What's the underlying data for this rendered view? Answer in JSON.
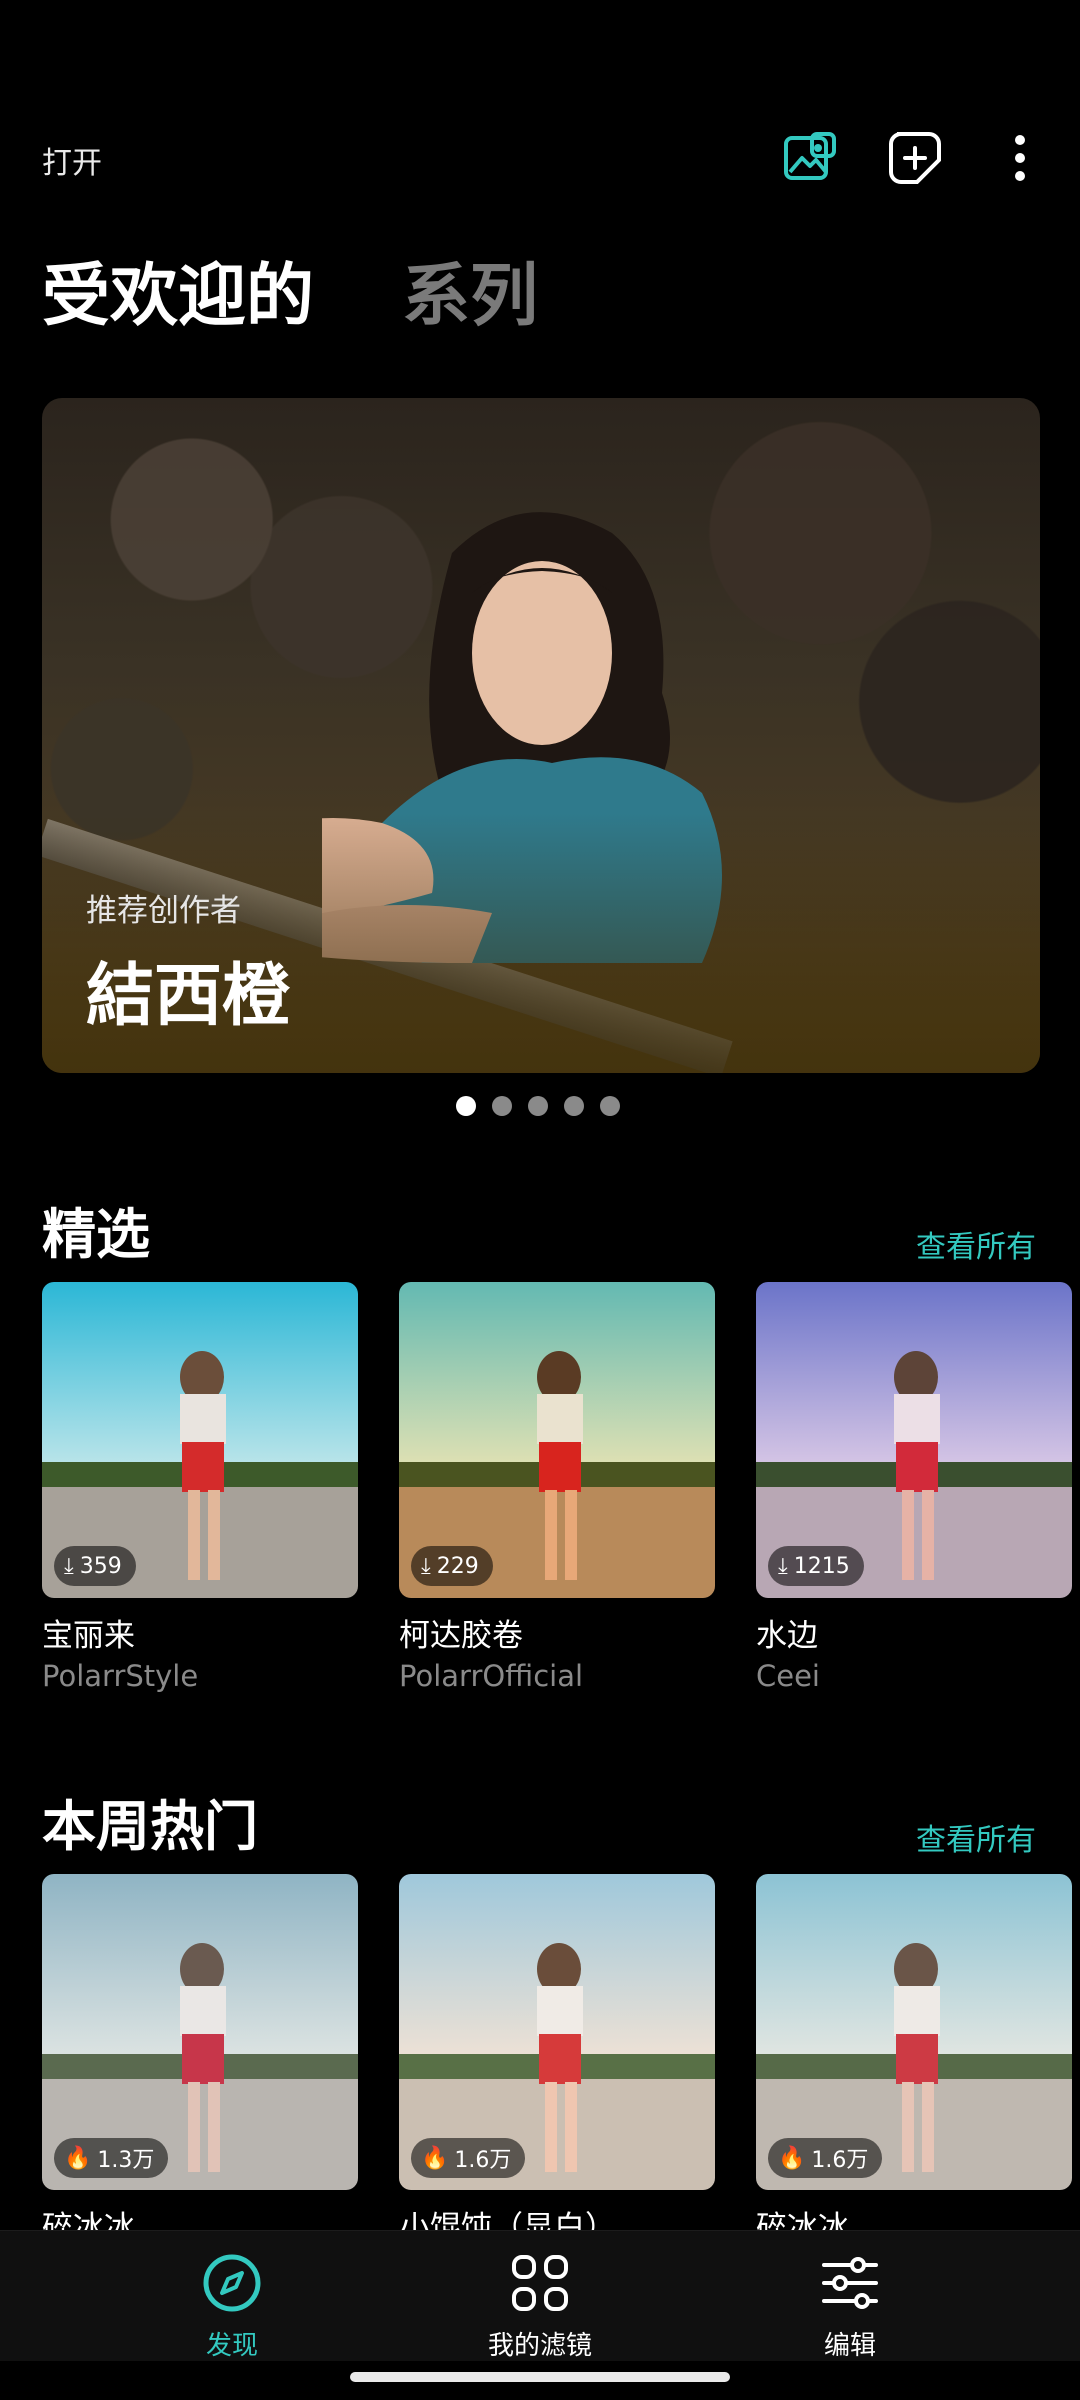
{
  "topbar": {
    "open_label": "打开",
    "icons": [
      "image-gallery-icon",
      "add-square-icon",
      "more-vertical-icon"
    ]
  },
  "tabs": [
    {
      "label": "受欢迎的",
      "active": true
    },
    {
      "label": "系列",
      "active": false
    }
  ],
  "hero": {
    "subtitle": "推荐创作者",
    "title": "結西橙",
    "page_count": 5,
    "active_page": 1
  },
  "featured": {
    "title": "精选",
    "see_all": "查看所有",
    "items": [
      {
        "name": "宝丽来",
        "author": "PolarrStyle",
        "count": "359",
        "badge_icon": "download-icon"
      },
      {
        "name": "柯达胶卷",
        "author": "PolarrOfficial",
        "count": "229",
        "badge_icon": "download-icon"
      },
      {
        "name": "水边",
        "author": "Ceei",
        "count": "1215",
        "badge_icon": "download-icon"
      }
    ]
  },
  "weekly": {
    "title": "本周热门",
    "see_all": "查看所有",
    "items": [
      {
        "name": "碎冰冰",
        "count": "1.3万",
        "badge_icon": "fire-icon"
      },
      {
        "name": "小馄饨（显白）",
        "count": "1.6万",
        "badge_icon": "fire-icon"
      },
      {
        "name": "碎冰冰",
        "count": "1.6万",
        "badge_icon": "fire-icon"
      }
    ]
  },
  "bottom_nav": [
    {
      "label": "发现",
      "icon": "compass-icon",
      "active": true
    },
    {
      "label": "我的滤镜",
      "icon": "grid-icon",
      "active": false
    },
    {
      "label": "编辑",
      "icon": "sliders-icon",
      "active": false
    }
  ],
  "colors": {
    "accent": "#33c9c0",
    "background": "#000000",
    "muted": "#7a7a7a"
  }
}
